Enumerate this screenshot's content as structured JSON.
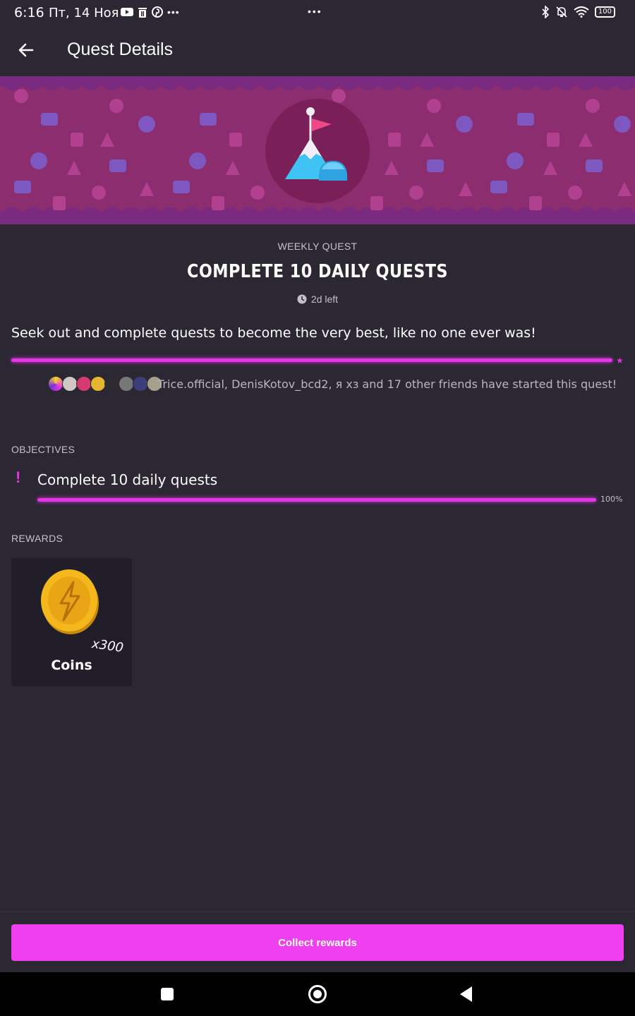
{
  "status_bar": {
    "time": "6:16",
    "date": "Пт, 14 Ноя",
    "battery": "100",
    "icons_left": [
      "youtube-icon",
      "trash-icon",
      "pinterest-icon",
      "more-icon"
    ],
    "icons_right": [
      "bluetooth-icon",
      "mute-icon",
      "wifi-icon",
      "battery-icon"
    ]
  },
  "header": {
    "title": "Quest Details"
  },
  "quest": {
    "type": "WEEKLY QUEST",
    "title": "COMPLETE 10 DAILY QUESTS",
    "time_left": "2d left",
    "description": "Seek out and complete quests to become the very best, like no one ever was!",
    "progress": 1.0,
    "friends_text": "Trice.official, DenisKotov_bcd2, я хз and 17 other friends have started this quest!"
  },
  "objectives": {
    "label": "OBJECTIVES",
    "items": [
      {
        "text": "Complete 10 daily quests",
        "percent_label": "100%",
        "progress": 1.0
      }
    ]
  },
  "rewards": {
    "label": "REWARDS",
    "items": [
      {
        "name": "Coins",
        "multiplier": "x300"
      }
    ]
  },
  "collect_button": "Collect rewards",
  "colors": {
    "background": "#2b2733",
    "accent": "#e535e6",
    "banner": "#8b2d6e"
  }
}
